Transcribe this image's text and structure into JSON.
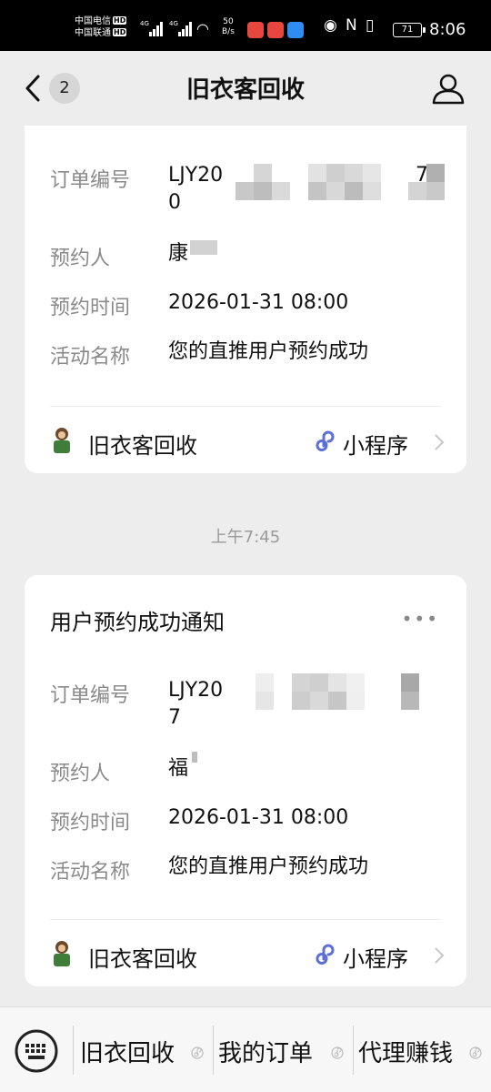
{
  "status_bar": {
    "carrier1": "中国电信",
    "carrier2": "中国联通",
    "hd": "HD",
    "net1": "4G",
    "net2": "4G",
    "speed_value": "50",
    "speed_unit": "B/s",
    "battery": "71",
    "time": "8:06"
  },
  "nav": {
    "unread_count": "2",
    "title": "旧衣客回收"
  },
  "messages": [
    {
      "title": "",
      "fields": [
        {
          "label": "订单编号",
          "value_line1": "LJY20",
          "value_tail1": "7",
          "value_line2": "0"
        },
        {
          "label": "预约人",
          "value": "康"
        },
        {
          "label": "预约时间",
          "value": "2026-01-31 08:00"
        },
        {
          "label": "活动名称",
          "value": "您的直推用户预约成功"
        }
      ],
      "footer": {
        "source_name": "旧衣客回收",
        "miniprogram_label": "小程序"
      }
    },
    {
      "title": "用户预约成功通知",
      "more": "•••",
      "fields": [
        {
          "label": "订单编号",
          "value_line1": "LJY20",
          "value_tail1": "",
          "value_line2": "7"
        },
        {
          "label": "预约人",
          "value": "福"
        },
        {
          "label": "预约时间",
          "value": "2026-01-31 08:00"
        },
        {
          "label": "活动名称",
          "value": "您的直推用户预约成功"
        }
      ],
      "footer": {
        "source_name": "旧衣客回收",
        "miniprogram_label": "小程序"
      }
    }
  ],
  "timestamp": "上午7:45",
  "bottom_menu": {
    "items": [
      {
        "label": "旧衣回收"
      },
      {
        "label": "我的订单"
      },
      {
        "label": "代理赚钱"
      }
    ]
  },
  "colors": {
    "background": "#ededed",
    "card": "#ffffff",
    "label_gray": "#8a8a8a",
    "miniprogram_blue": "#5b6fd6"
  },
  "icons": [
    "back-arrow-icon",
    "profile-icon",
    "more-icon",
    "miniprogram-icon",
    "chevron-right-icon",
    "keyboard-icon",
    "official-account-avatar"
  ]
}
